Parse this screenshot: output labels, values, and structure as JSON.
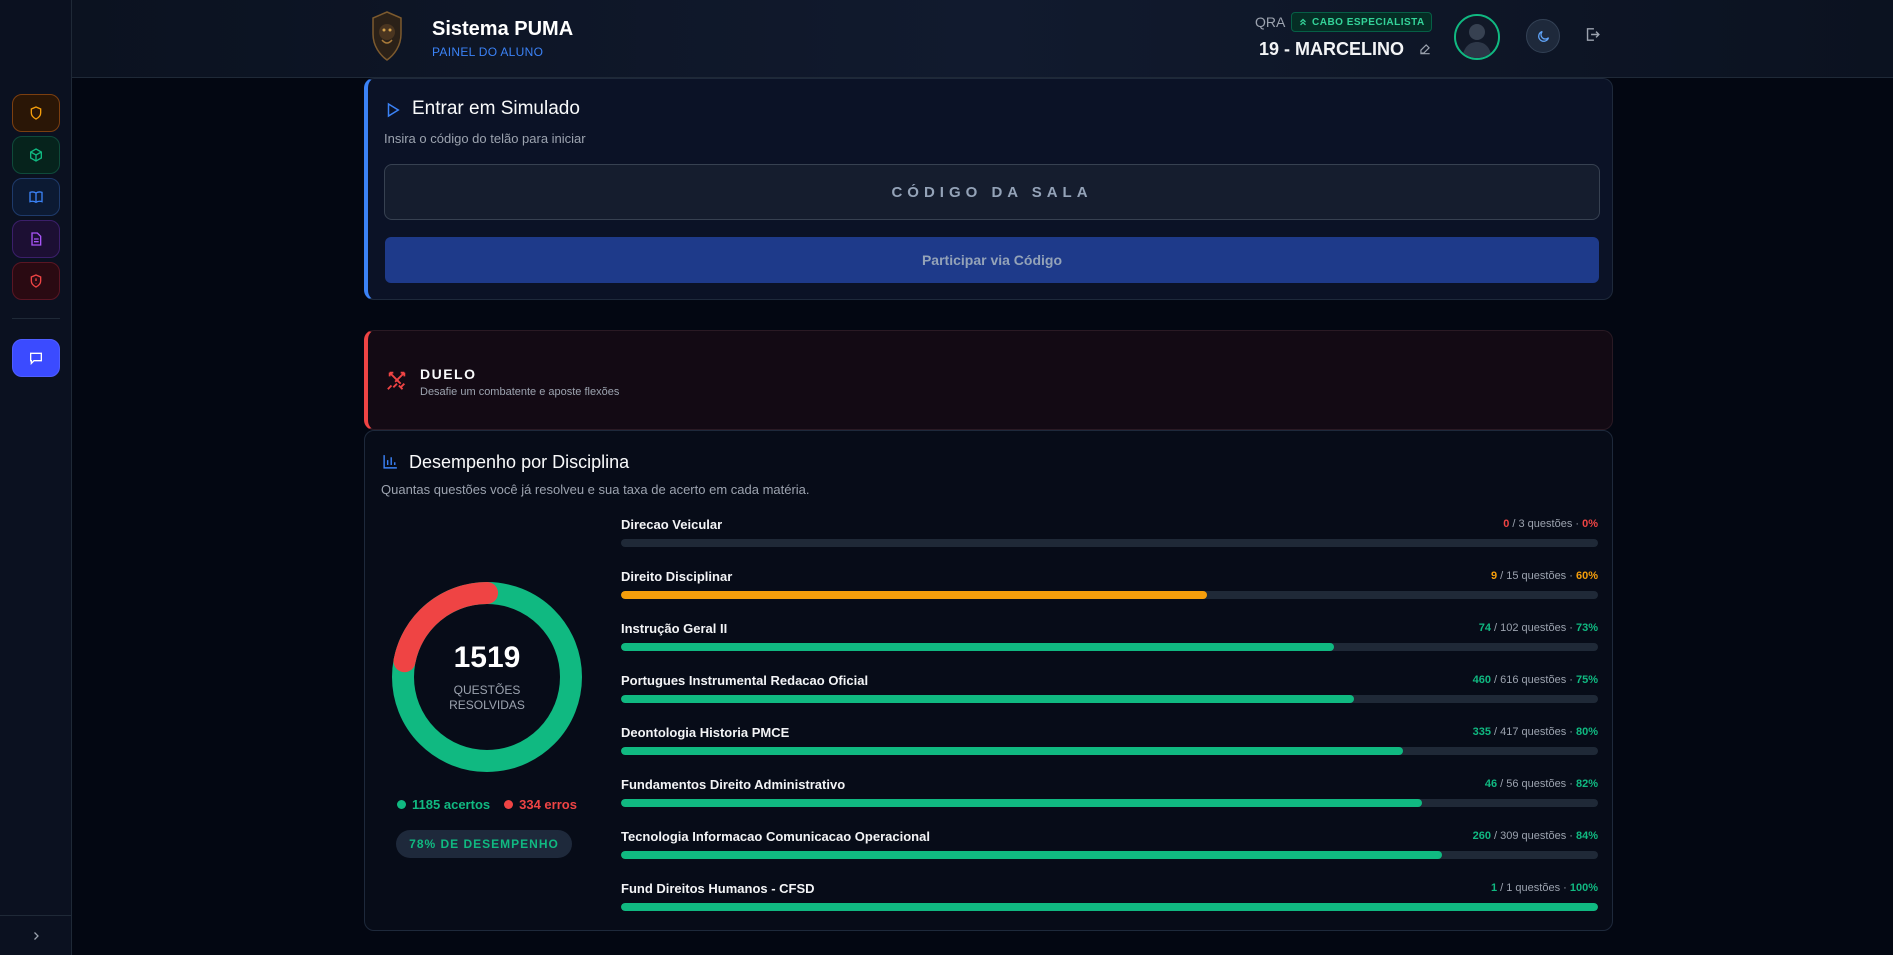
{
  "app": {
    "title": "Sistema PUMA",
    "subtitle": "PAINEL DO ALUNO"
  },
  "user": {
    "qra_label": "QRA",
    "rank": "CABO ESPECIALISTA",
    "name": "19 - MARCELINO"
  },
  "sidebar": {
    "items": [
      {
        "icon": "shield-icon",
        "color": "#f59e0b"
      },
      {
        "icon": "cube-icon",
        "color": "#10b981"
      },
      {
        "icon": "book-icon",
        "color": "#3b82f6"
      },
      {
        "icon": "document-icon",
        "color": "#a855f7"
      },
      {
        "icon": "shield-alert-icon",
        "color": "#ef4444"
      },
      {
        "icon": "chat-icon",
        "color": "#ffffff"
      }
    ]
  },
  "simulado": {
    "title": "Entrar em Simulado",
    "subtitle": "Insira o código do telão para iniciar",
    "code_placeholder": "CÓDIGO DA SALA",
    "join_label": "Participar via Código"
  },
  "duel": {
    "title": "DUELO",
    "subtitle": "Desafie um combatente e aposte flexões"
  },
  "performance": {
    "title": "Desempenho por Disciplina",
    "subtitle": "Quantas questões você já resolveu e sua taxa de acerto em cada matéria.",
    "total": "1519",
    "total_label_1": "QUESTÕES",
    "total_label_2": "RESOLVIDAS",
    "correct": 1185,
    "wrong": 334,
    "correct_label": "1185 acertos",
    "wrong_label": "334 erros",
    "score_label": "78% DE DESEMPENHO",
    "colors": {
      "good": "#10b981",
      "mid": "#f59e0b",
      "bad": "#ef4444"
    },
    "subjects": [
      {
        "name": "Direcao Veicular",
        "correct": "0",
        "total_text": " / 3 questões · ",
        "pct_text": "0%",
        "pct": 0,
        "color": "#ef4444"
      },
      {
        "name": "Direito Disciplinar",
        "correct": "9",
        "total_text": " / 15 questões · ",
        "pct_text": "60%",
        "pct": 60,
        "color": "#f59e0b"
      },
      {
        "name": "Instrução Geral II",
        "correct": "74",
        "total_text": " / 102 questões · ",
        "pct_text": "73%",
        "pct": 73,
        "color": "#10b981"
      },
      {
        "name": "Portugues Instrumental Redacao Oficial",
        "correct": "460",
        "total_text": " / 616 questões · ",
        "pct_text": "75%",
        "pct": 75,
        "color": "#10b981"
      },
      {
        "name": "Deontologia Historia PMCE",
        "correct": "335",
        "total_text": " / 417 questões · ",
        "pct_text": "80%",
        "pct": 80,
        "color": "#10b981"
      },
      {
        "name": "Fundamentos Direito Administrativo",
        "correct": "46",
        "total_text": " / 56 questões · ",
        "pct_text": "82%",
        "pct": 82,
        "color": "#10b981"
      },
      {
        "name": "Tecnologia Informacao Comunicacao Operacional",
        "correct": "260",
        "total_text": " / 309 questões · ",
        "pct_text": "84%",
        "pct": 84,
        "color": "#10b981"
      },
      {
        "name": "Fund Direitos Humanos - CFSD",
        "correct": "1",
        "total_text": " / 1 questões · ",
        "pct_text": "100%",
        "pct": 100,
        "color": "#10b981"
      }
    ]
  }
}
